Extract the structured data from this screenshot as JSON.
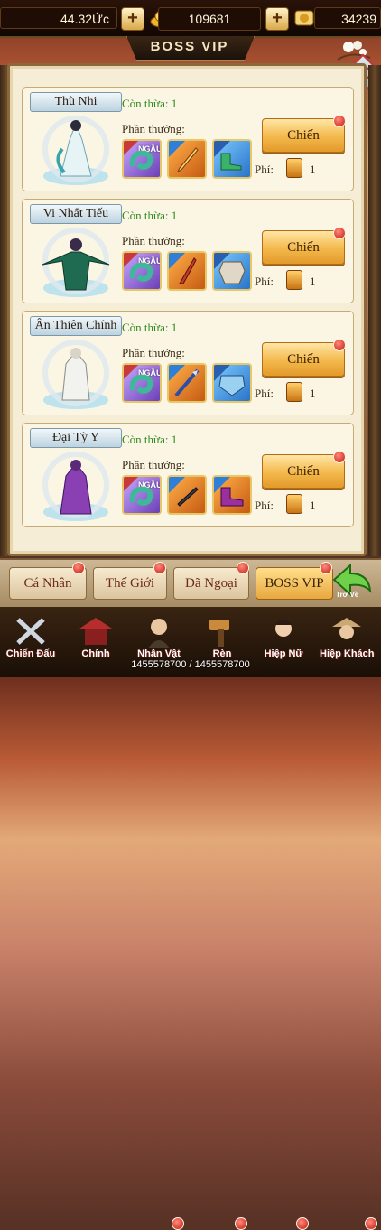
{
  "resources": {
    "gold": "44.32Ức",
    "ingots": "109681",
    "coupons": "34239"
  },
  "title": "BOSS VIP",
  "bosses": [
    {
      "name": "Thù Nhi",
      "remaining": "Còn thừa:  1",
      "rewards_label": "Phần thưởng:",
      "fight_label": "Chiến",
      "fee_label": "Phí:",
      "fee_value": "1"
    },
    {
      "name": "Vi Nhất Tiếu",
      "remaining": "Còn thừa:  1",
      "rewards_label": "Phần thưởng:",
      "fight_label": "Chiến",
      "fee_label": "Phí:",
      "fee_value": "1"
    },
    {
      "name": "Ân Thiên Chính",
      "remaining": "Còn thừa:  1",
      "rewards_label": "Phần thưởng:",
      "fight_label": "Chiến",
      "fee_label": "Phí:",
      "fee_value": "1"
    },
    {
      "name": "Đại Tỳ Y",
      "remaining": "Còn thừa:  1",
      "rewards_label": "Phần thưởng:",
      "fight_label": "Chiến",
      "fee_label": "Phí:",
      "fee_value": "1"
    }
  ],
  "reward_badge": "NGẦU",
  "tabs": [
    {
      "label": "Cá Nhân"
    },
    {
      "label": "Thế Giới"
    },
    {
      "label": "Dã Ngoại"
    },
    {
      "label": "BOSS VIP"
    }
  ],
  "back_label": "Trở Về",
  "nav": [
    {
      "label": "Chiến Đấu"
    },
    {
      "label": "Chính"
    },
    {
      "label": "Nhân Vật"
    },
    {
      "label": "Rèn"
    },
    {
      "label": "Hiệp Nữ"
    },
    {
      "label": "Hiệp Khách"
    }
  ],
  "exp_text": "1455578700 / 1455578700",
  "colors": {
    "remaining": "#2d8b1e",
    "fight_button": "#f3b84a",
    "alert_dot": "#c21a12"
  }
}
